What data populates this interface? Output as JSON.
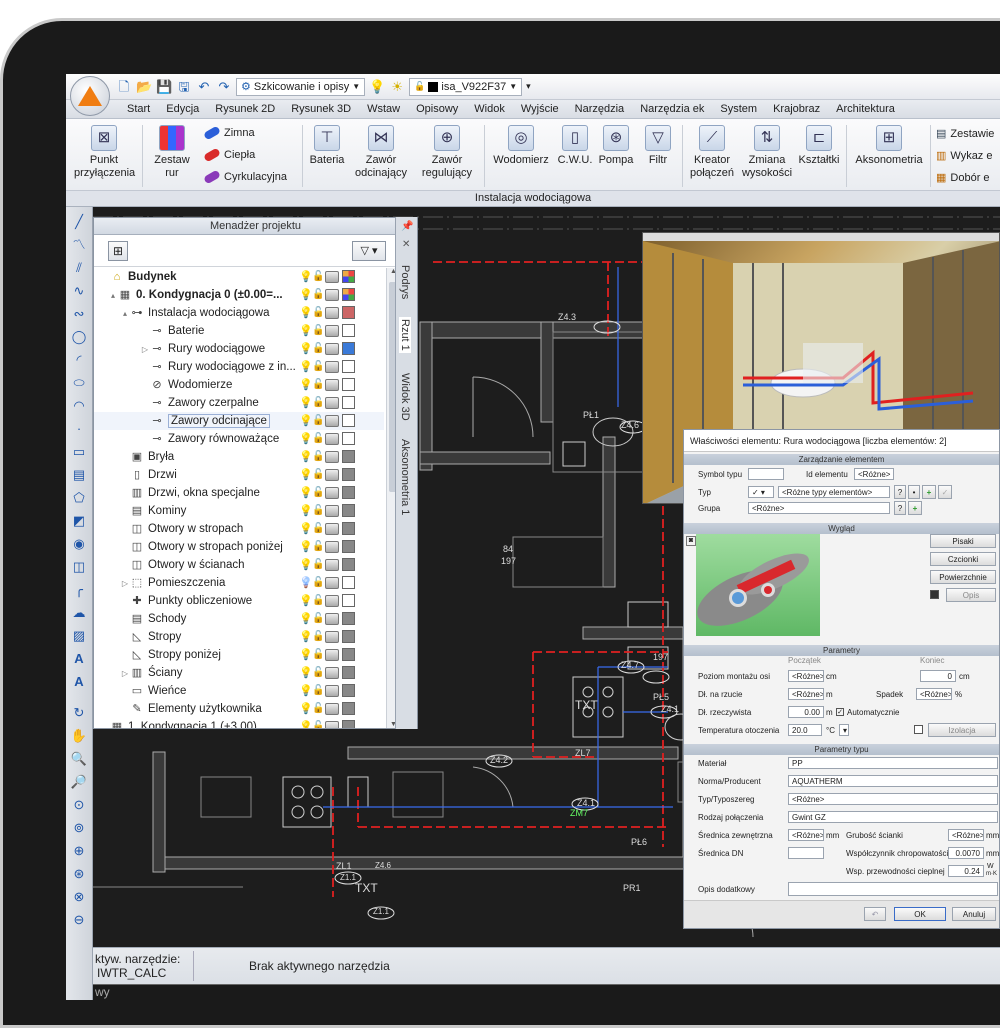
{
  "quick_access": {
    "mode_combo": "Szkicowanie i opisy",
    "layer_combo": "isa_V922F37"
  },
  "menu": [
    "Start",
    "Edycja",
    "Rysunek 2D",
    "Rysunek 3D",
    "Wstaw",
    "Opisowy",
    "Widok",
    "Wyjście",
    "Narzędzia",
    "Narzędzia ek",
    "System",
    "Krajobraz",
    "Architektura"
  ],
  "ribbon": {
    "punkt": [
      "Punkt",
      "przyłączenia"
    ],
    "zestaw": [
      "Zestaw",
      "rur"
    ],
    "zimna": "Zimna",
    "ciepla": "Ciepła",
    "cyrkulacyjna": "Cyrkulacyjna",
    "bateria": "Bateria",
    "zawor_odc": [
      "Zawór",
      "odcinający"
    ],
    "zawor_reg": [
      "Zawór",
      "regulujący"
    ],
    "wodomierz": "Wodomierz",
    "cwu": "C.W.U.",
    "pompa": "Pompa",
    "filtr": "Filtr",
    "kreator": [
      "Kreator",
      "połączeń"
    ],
    "zmiana": [
      "Zmiana",
      "wysokości"
    ],
    "ksztaltki": "Kształtki",
    "aksonometria": "Aksonometria",
    "zestaw_r": "Zestawie",
    "wykaz_r": "Wykaz e",
    "dobor_r": "Dobór e",
    "group_label": "Instalacja wodociągowa"
  },
  "project_manager": {
    "title": "Menadżer projektu",
    "items": [
      {
        "label": "Budynek",
        "bold": true
      },
      {
        "label": "0. Kondygnacja 0 (±0.00=...",
        "bold": true
      },
      {
        "label": "Instalacja wodociągowa"
      },
      {
        "label": "Baterie"
      },
      {
        "label": "Rury wodociągowe"
      },
      {
        "label": "Rury wodociągowe z in..."
      },
      {
        "label": "Wodomierze"
      },
      {
        "label": "Zawory czerpalne"
      },
      {
        "label": "Zawory odcinające"
      },
      {
        "label": "Zawory równoważące"
      },
      {
        "label": "Bryła"
      },
      {
        "label": "Drzwi"
      },
      {
        "label": "Drzwi, okna specjalne"
      },
      {
        "label": "Kominy"
      },
      {
        "label": "Otwory w stropach"
      },
      {
        "label": "Otwory w stropach poniżej"
      },
      {
        "label": "Otwory w ścianach"
      },
      {
        "label": "Pomieszczenia"
      },
      {
        "label": "Punkty obliczeniowe"
      },
      {
        "label": "Schody"
      },
      {
        "label": "Stropy"
      },
      {
        "label": "Stropy poniżej"
      },
      {
        "label": "Ściany"
      },
      {
        "label": "Wieńce"
      },
      {
        "label": "Elementy użytkownika"
      },
      {
        "label": "1. Kondygnacja 1 (+3.00)"
      }
    ]
  },
  "side_tabs": [
    "Podrys",
    "Rzut 1",
    "Widok 3D",
    "Aksonometria 1"
  ],
  "cad_labels": {
    "z43": "Z4.3",
    "pl1": "PŁ1",
    "z46": "Z4.6",
    "room_a": "84",
    "room_b": "197",
    "z47": "Z4.7",
    "txt1": "TXT",
    "pl5": "PŁ5",
    "z41": "Z4.1",
    "zl7": "ZL7",
    "z42": "Z4.2",
    "z41b": "Z4.1",
    "zm7": "ZM7",
    "pl6": "PŁ6",
    "pr1": "PR1",
    "zl1": "ZL1",
    "txt2": "TXT",
    "z11": "Z1.1",
    "z11b": "Z1.1",
    "z4_6": "Z4.6",
    "n197": "197"
  },
  "properties": {
    "title": "Właściwości elementu: Rura wodociągowa [liczba elementów: 2]",
    "g_zarz": "Zarządzanie elementem",
    "symbol_typu": "Symbol typu",
    "id_elementu": "Id elementu",
    "id_val": "<Różne>",
    "typ": "Typ",
    "typ_val": "<Różne typy elementów>",
    "grupa": "Grupa",
    "grupa_val": "<Różne>",
    "g_wyglad": "Wygląd",
    "pisaki": "Pisaki",
    "czcionki": "Czcionki",
    "powierzchnie": "Powierzchnie",
    "opis": "Opis",
    "g_param": "Parametry",
    "poczatek": "Początek",
    "koniec": "Koniec",
    "poziom": "Poziom montażu osi",
    "poziom_val": "<Różne>",
    "cm": "cm",
    "koniec_val": "0",
    "dl_rzucie": "Dł. na rzucie",
    "dl_rzucie_val": "<Różne>",
    "m": "m",
    "spadek": "Spadek",
    "spadek_val": "<Różne>",
    "pct": "%",
    "dl_rzecz": "Dł. rzeczywista",
    "dl_rzecz_val": "0.00",
    "automat": "Automatycznie",
    "temp": "Temperatura otoczenia",
    "temp_val": "20.0",
    "degc": "°C",
    "izolacja": "Izolacja",
    "g_typ": "Parametry typu",
    "material": "Materiał",
    "material_val": "PP",
    "norma": "Norma/Producent",
    "norma_val": "AQUATHERM",
    "typosz": "Typ/Typoszereg",
    "typosz_val": "<Różne>",
    "rodzaj": "Rodzaj połączenia",
    "rodzaj_val": "Gwint GZ",
    "sred_zew": "Średnica zewnętrzna",
    "sred_zew_val": "<Różne>",
    "mm": "mm",
    "grubosc": "Grubość ścianki",
    "grubosc_val": "<Różne>",
    "sred_dn": "Średnica DN",
    "wsp_chrop": "Współczynnik chropowatości",
    "wsp_chrop_val": "0.0070",
    "wsp_przew": "Wsp. przewodności cieplnej",
    "wsp_przew_val": "0.24",
    "unit_w": "W",
    "unit_mk": "m·K",
    "opis_dod": "Opis dodatkowy",
    "ok": "OK",
    "anuluj": "Anuluj"
  },
  "status_bar": {
    "tool_label": "ktyw. narzędzie:",
    "tool_value": "IWTR_CALC",
    "message": "Brak aktywnego narzędzia",
    "bottom": "wy"
  },
  "colors": {
    "accent": "#f07d12",
    "cad_bg": "#1d1d1d",
    "pipe_red": "#e02020",
    "pipe_blue": "#3a6cf0",
    "highlight": "#f0f4fb"
  }
}
